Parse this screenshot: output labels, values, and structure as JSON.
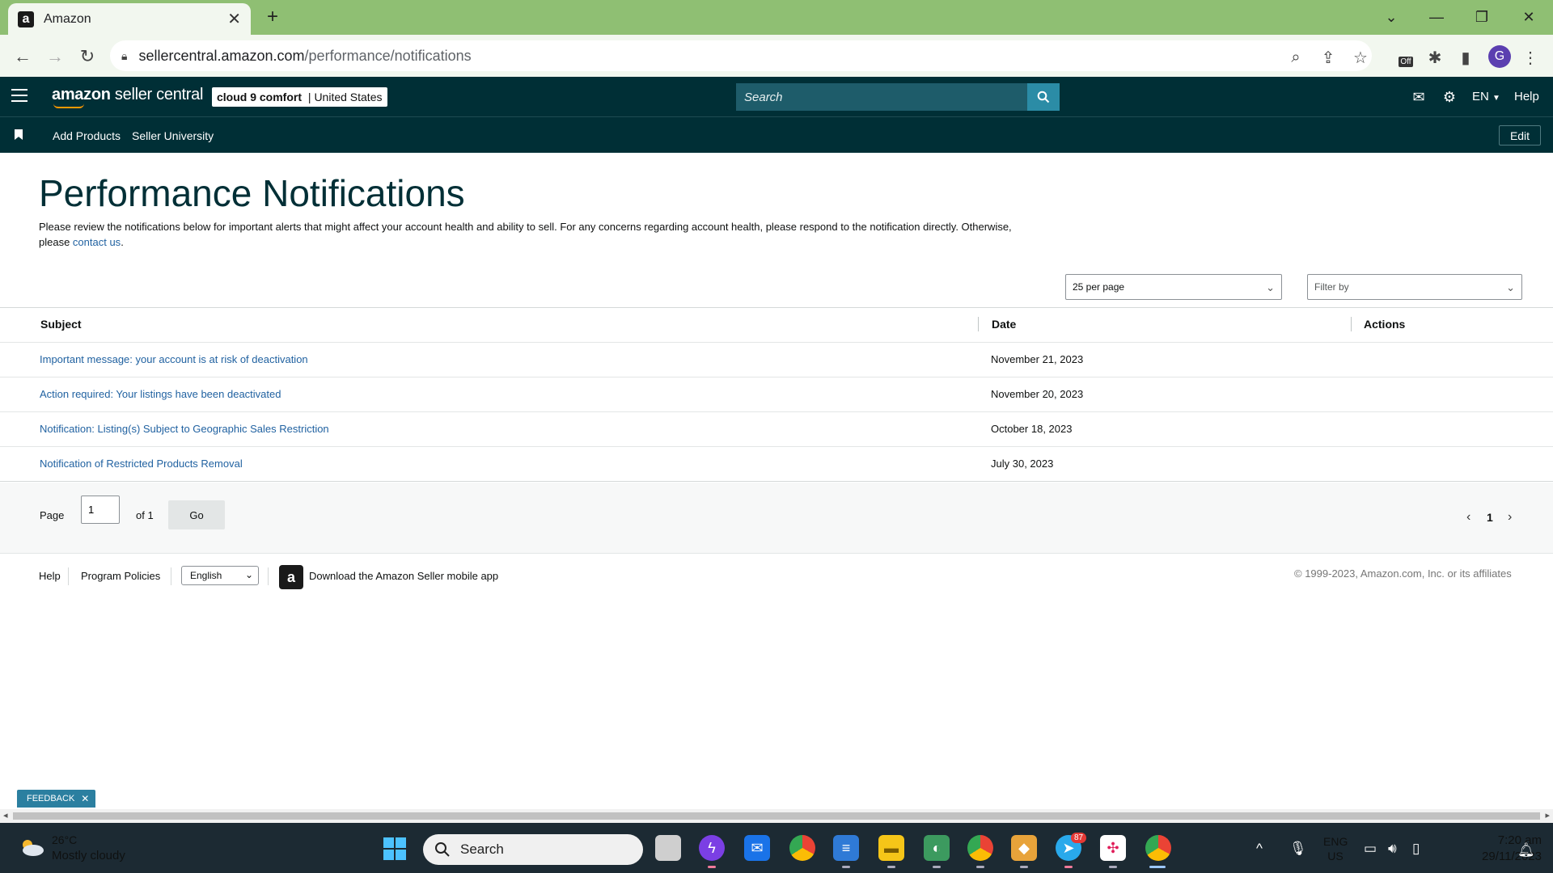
{
  "browser": {
    "tab_title": "Amazon",
    "tab_favicon": "amazon-a-icon",
    "url_domain": "sellercentral.amazon.com",
    "url_path": "/performance/notifications",
    "profile_initial": "G",
    "extension_badge": "Off"
  },
  "header": {
    "logo_bold": "amazon",
    "logo_rest": " seller central",
    "account_name": "cloud 9 comfort",
    "account_sep": " | ",
    "account_region": "United States",
    "search_placeholder": "Search",
    "language": "EN",
    "help": "Help"
  },
  "subheader": {
    "links": [
      "Add Products",
      "Seller University"
    ],
    "edit_label": "Edit"
  },
  "page": {
    "title": "Performance Notifications",
    "description_prefix": "Please review the notifications below for important alerts that might affect your account health and ability to sell. For any concerns regarding account health, please respond to the notification directly. Otherwise, please ",
    "contact_link": "contact us",
    "description_suffix": ".",
    "per_page": "25 per page",
    "filter_placeholder": "Filter by"
  },
  "table": {
    "headers": {
      "subject": "Subject",
      "date": "Date",
      "actions": "Actions"
    },
    "rows": [
      {
        "subject": "Important message: your account is at risk of deactivation",
        "date": "November 21, 2023"
      },
      {
        "subject": "Action required: Your listings have been deactivated",
        "date": "November 20, 2023"
      },
      {
        "subject": "Notification: Listing(s) Subject to Geographic Sales Restriction",
        "date": "October 18, 2023"
      },
      {
        "subject": "Notification of Restricted Products Removal",
        "date": "July 30, 2023"
      }
    ]
  },
  "pagination": {
    "page_label": "Page",
    "current": "1",
    "of_label": "of 1",
    "go_label": "Go",
    "page_number": "1"
  },
  "footer": {
    "help": "Help",
    "program_policies": "Program Policies",
    "language": "English",
    "app_text": "Download the Amazon Seller mobile app",
    "copyright": "© 1999-2023, Amazon.com, Inc. or its affiliates",
    "feedback": "FEEDBACK"
  },
  "taskbar": {
    "temperature": "26°C",
    "weather": "Mostly cloudy",
    "search": "Search",
    "telegram_badge": "87",
    "lang_top": "ENG",
    "lang_bottom": "US",
    "time": "7:20 am",
    "date": "29/11/2023"
  },
  "colors": {
    "header_bg": "#002f36",
    "link": "#2162a1",
    "tab_strip": "#8fbf73",
    "taskbar": "#1c2a33"
  }
}
